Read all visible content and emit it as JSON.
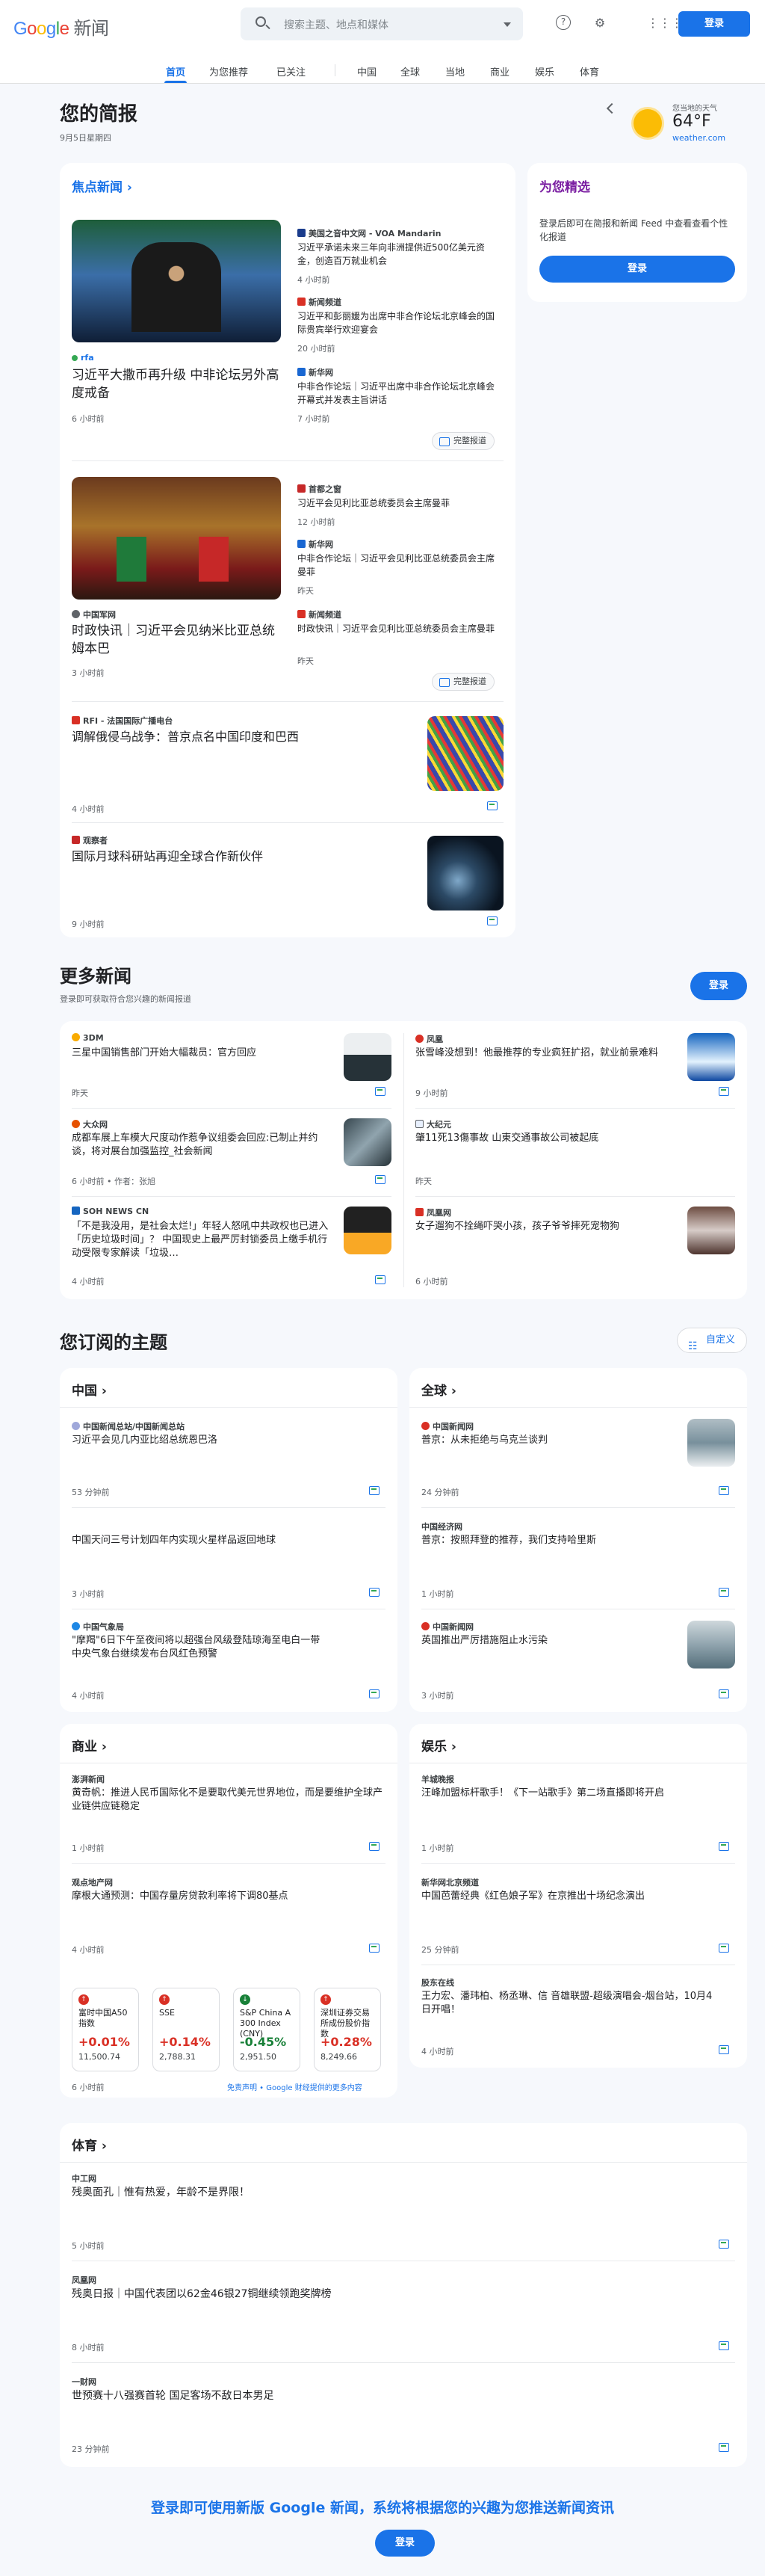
{
  "header": {
    "logo_letters": [
      "G",
      "o",
      "o",
      "g",
      "l",
      "e"
    ],
    "logo_suffix": "新闻",
    "search_placeholder": "搜索主题、地点和媒体",
    "login": "登录"
  },
  "nav": {
    "tabs": [
      "首页",
      "为您推荐",
      "已关注",
      "中国",
      "全球",
      "当地",
      "商业",
      "娱乐",
      "体育"
    ],
    "active": "首页"
  },
  "briefing": {
    "title": "您的简报",
    "date": "9月5日星期四"
  },
  "weather": {
    "caption": "您当地的天气",
    "temp": "64°F",
    "source": "weather.com"
  },
  "for_you": {
    "title": "为您精选",
    "text": "登录后即可在简报和新闻 Feed 中查看查看个性化报道",
    "button": "登录"
  },
  "headlines": {
    "title": "焦点新闻",
    "stories": [
      {
        "main_source": "rfa",
        "main_title": "习近平大撒币再升级 中非论坛另外高度戒备",
        "main_time": "6 小时前",
        "related": [
          {
            "source": "美国之音中文网 - VOA Mandarin",
            "title": "习近平承诺未来三年向非洲提供近500亿美元资金，创造百万就业机会",
            "time": "4 小时前"
          },
          {
            "source": "新闻频道",
            "title": "习近平和彭丽媛为出席中非合作论坛北京峰会的国际贵宾举行欢迎宴会",
            "time": "20 小时前"
          },
          {
            "source": "新华网",
            "title": "中非合作论坛｜习近平出席中非合作论坛北京峰会开幕式并发表主旨讲话",
            "time": "7 小时前"
          }
        ],
        "full": "完整报道"
      },
      {
        "main_source": "中国军网",
        "main_title": "时政快讯｜习近平会见纳米比亚总统姆本巴",
        "main_time": "3 小时前",
        "related": [
          {
            "source": "首都之窗",
            "title": "习近平会见利比亚总统委员会主席曼菲",
            "time": "12 小时前"
          },
          {
            "source": "新华网",
            "title": "中非合作论坛｜习近平会见利比亚总统委员会主席曼菲",
            "time": "昨天"
          },
          {
            "source": "新闻频道",
            "title": "时政快讯｜习近平会见利比亚总统委员会主席曼菲",
            "time": "昨天"
          }
        ],
        "full": "完整报道"
      },
      {
        "main_source": "RFI - 法国国际广播电台",
        "main_title": "调解俄侵乌战争：普京点名中国印度和巴西",
        "main_time": "4 小时前"
      },
      {
        "main_source": "观察者",
        "main_title": "国际月球科研站再迎全球合作新伙伴",
        "main_time": "9 小时前"
      }
    ]
  },
  "more_news": {
    "title": "更多新闻",
    "subtitle": "登录即可获取符合您兴趣的新闻报道",
    "login": "登录",
    "items": [
      {
        "source": "3DM",
        "title": "三星中国销售部门开始大幅裁员：官方回应",
        "time": "昨天"
      },
      {
        "source": "凤凰",
        "title": "张雪峰没想到！他最推荐的专业疯狂扩招，就业前景难料",
        "time": "9 小时前"
      },
      {
        "source": "大众网",
        "title": "成都车展上车模大尺度动作惹争议组委会回应:已制止并约谈，将对展台加强监控_社会新闻",
        "time": "6 小时前 • 作者：张旭"
      },
      {
        "source": "大纪元",
        "title": "肇11死13傷事故 山東交通事故公司被起底",
        "time": "昨天"
      },
      {
        "source": "SOH NEWS CN",
        "title": "「不是我没用，是社会太烂!」年轻人怒吼中共政权也已进入「历史垃圾时间」？ 中国现史上最严厉封锁委员上缴手机行动受限专家解读「垃圾…",
        "time": "4 小时前"
      },
      {
        "source": "凤凰网",
        "title": "女子遛狗不拴绳吓哭小孩，孩子爷爷摔死宠物狗",
        "time": "6 小时前"
      }
    ]
  },
  "topics": {
    "title": "您订阅的主题",
    "customize": "自定义",
    "china": {
      "title": "中国",
      "items": [
        {
          "source": "中国新闻总站/中国新闻总站",
          "title": "习近平会见几内亚比绍总统恩巴洛",
          "time": "53 分钟前"
        },
        {
          "source": "",
          "title": "中国天问三号计划四年内实现火星样品返回地球",
          "time": "3 小时前"
        },
        {
          "source": "中国气象局",
          "title": "\"摩羯\"6日下午至夜间将以超强台风级登陆琼海至电白一带中央气象台继续发布台风红色预警",
          "time": "4 小时前"
        }
      ]
    },
    "world": {
      "title": "全球",
      "items": [
        {
          "source": "中国新闻网",
          "title": "普京：从未拒绝与乌克兰谈判",
          "time": "24 分钟前"
        },
        {
          "source": "中国经济网",
          "title": "普京：按照拜登的推荐，我们支持哈里斯",
          "time": "1 小时前"
        },
        {
          "source": "中国新闻网",
          "title": "英国推出严厉措施阻止水污染",
          "time": "3 小时前"
        }
      ]
    },
    "business": {
      "title": "商业",
      "items": [
        {
          "source": "澎湃新闻",
          "title": "黄奇帆：推进人民币国际化不是要取代美元世界地位，而是要维护全球产业链供应链稳定",
          "time": "1 小时前"
        },
        {
          "source": "观点地产网",
          "title": "摩根大通预测：中国存量房贷款利率将下调80基点",
          "time": "4 小时前"
        }
      ],
      "stocks": [
        {
          "name": "富时中国A50指数",
          "change": "+0.01%",
          "value": "11,500.74",
          "dir": "up"
        },
        {
          "name": "SSE",
          "change": "+0.14%",
          "value": "2,788.31",
          "dir": "up"
        },
        {
          "name": "S&P China A 300 Index (CNY)",
          "change": "-0.45%",
          "value": "2,951.50",
          "dir": "down"
        },
        {
          "name": "深圳证券交易所成份股价指数",
          "change": "+0.28%",
          "value": "8,249.66",
          "dir": "up"
        }
      ],
      "time": "6 小时前",
      "disclaimer": "免责声明 • Google 财经提供的更多内容"
    },
    "entertainment": {
      "title": "娱乐",
      "items": [
        {
          "source": "羊城晚报",
          "title": "汪峰加盟标杆歌手！《下一站歌手》第二场直播即将开启",
          "time": "1 小时前"
        },
        {
          "source": "新华网北京频道",
          "title": "中国芭蕾经典《红色娘子军》在京推出十场纪念演出",
          "time": "25 分钟前"
        },
        {
          "source": "股东在线",
          "title": "王力宏、潘玮柏、杨丞琳、信 音雄联盟-超级演唱会-烟台站，10月4日开唱！",
          "time": "4 小时前"
        }
      ]
    },
    "sports": {
      "title": "体育",
      "items": [
        {
          "source": "中工网",
          "title": "残奥面孔｜惟有热爱，年龄不是界限！",
          "time": "5 小时前"
        },
        {
          "source": "凤凰网",
          "title": "残奥日报｜中国代表团以62金46银27铜继续领跑奖牌榜",
          "time": "8 小时前"
        },
        {
          "source": "一财网",
          "title": "世预赛十八强赛首轮 国足客场不敌日本男足",
          "time": "23 分钟前"
        }
      ]
    }
  },
  "footer": {
    "text": "登录即可使用新版 Google 新闻，系统将根据您的兴趣为您推送新闻资讯",
    "login": "登录"
  },
  "colors": {
    "accent": "#1a73e8",
    "up": "#d93025",
    "down": "#188038"
  }
}
